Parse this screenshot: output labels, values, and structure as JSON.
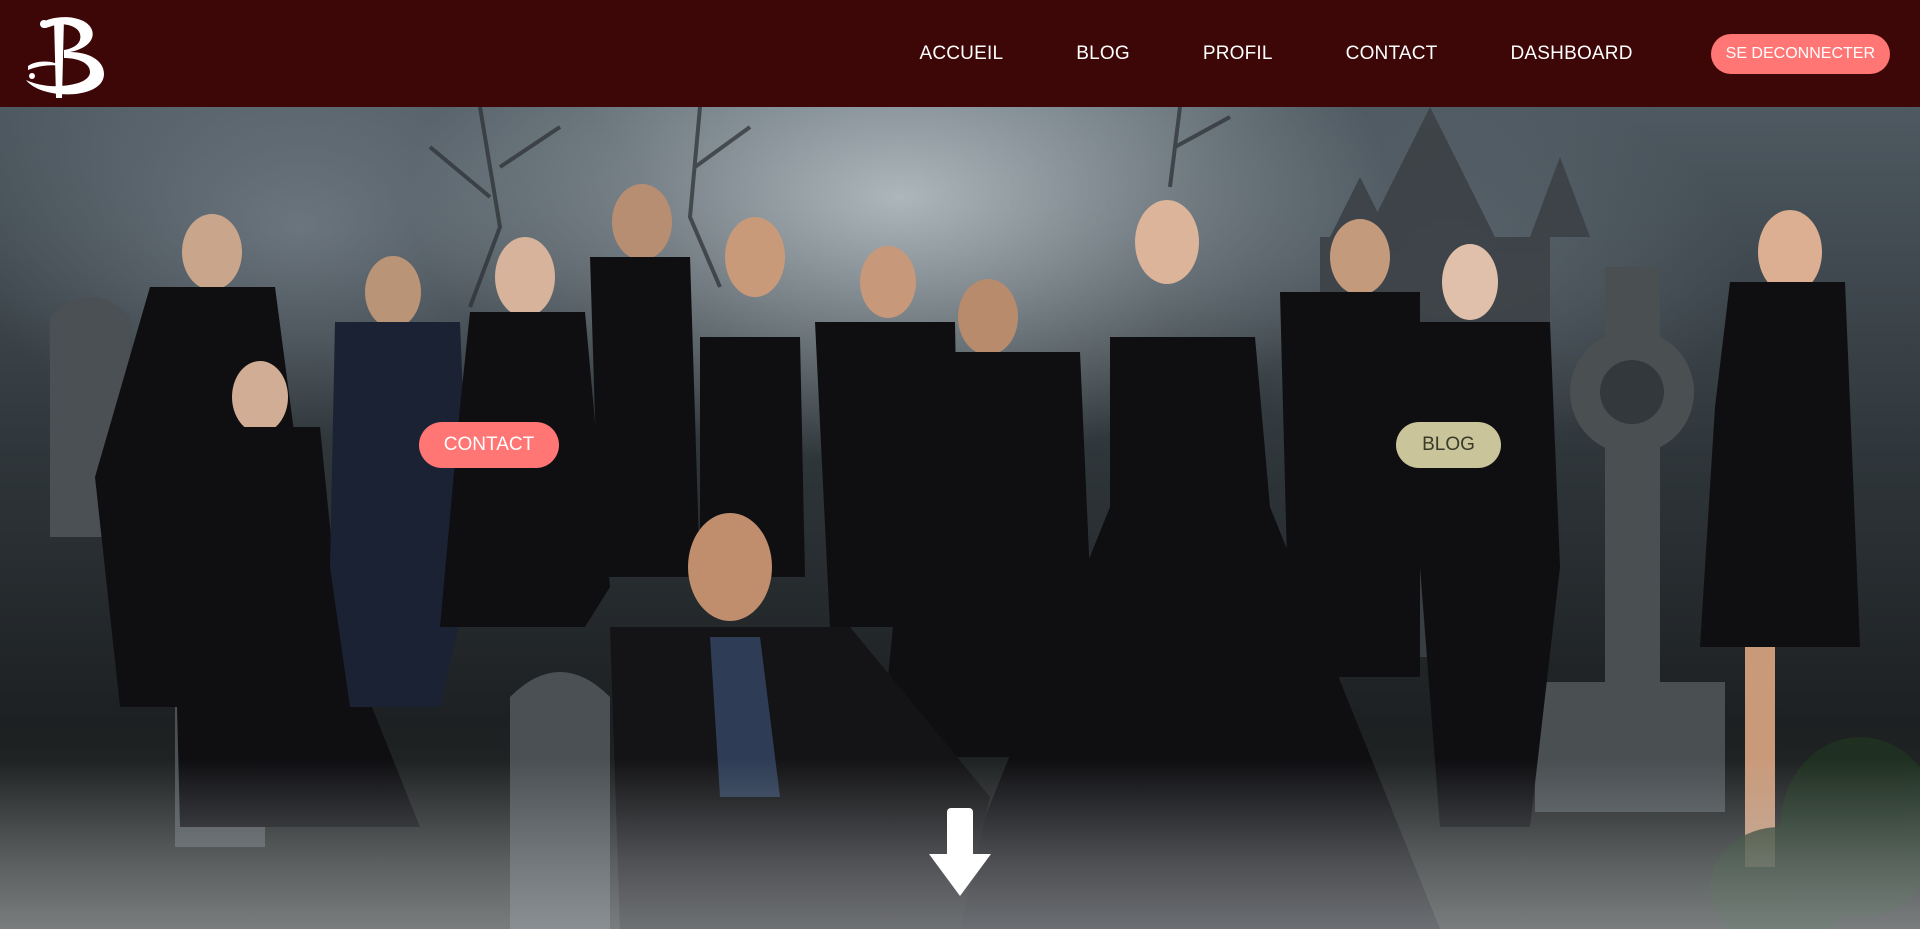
{
  "header": {
    "logo_icon": "buffy-b-logo-icon",
    "nav": [
      {
        "label": "ACCUEIL"
      },
      {
        "label": "BLOG"
      },
      {
        "label": "PROFIL"
      },
      {
        "label": "CONTACT"
      },
      {
        "label": "DASHBOARD"
      }
    ],
    "logout_label": "SE DECONNECTER"
  },
  "hero": {
    "contact_button": "CONTACT",
    "blog_button": "BLOG",
    "scroll_icon": "arrow-down-icon"
  },
  "colors": {
    "navbar_bg": "#3e0707",
    "accent": "#ff7675",
    "blog_pill": "#c9c49a"
  }
}
